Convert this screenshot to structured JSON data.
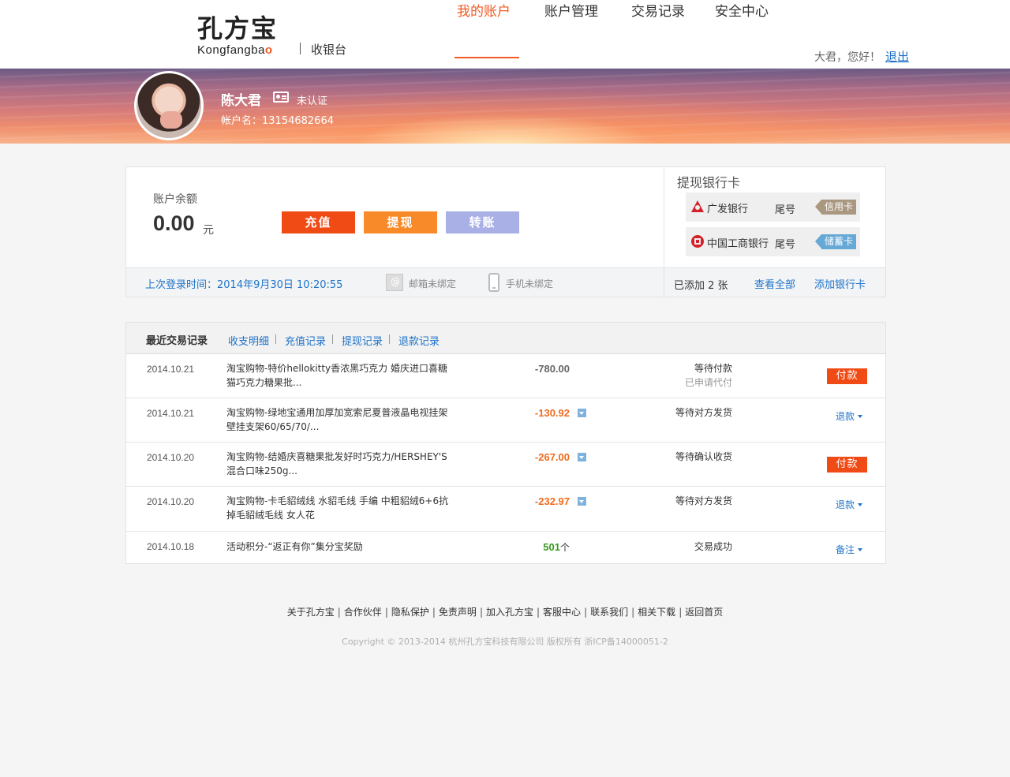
{
  "header": {
    "logo_cn": "孔方宝",
    "logo_en_prefix": "Kongfangba",
    "logo_en_suffix": "o",
    "subtitle": "收银台",
    "nav": [
      "我的账户",
      "账户管理",
      "交易记录",
      "安全中心"
    ],
    "greeting": "大君，您好！",
    "logout": "退出"
  },
  "profile": {
    "name": "陈大君",
    "verify_status": "未认证",
    "account_name": "帐户名：13154682664"
  },
  "account": {
    "balance_label": "账户余额",
    "balance": "0.00",
    "unit": "元",
    "buttons": {
      "recharge": "充值",
      "withdraw": "提现",
      "transfer": "转账"
    },
    "last_login": "上次登录时间：2014年9月30日   10:20:55",
    "email_status": "邮箱未绑定",
    "phone_status": "手机未绑定"
  },
  "bank_cards": {
    "title": "提现银行卡",
    "cards": [
      {
        "bank": "广发银行",
        "tail": "尾号",
        "type": "信用卡"
      },
      {
        "bank": "中国工商银行",
        "tail": "尾号",
        "type": "储蓄卡"
      }
    ],
    "added": "已添加 2 张",
    "view_all": "查看全部",
    "add_card": "添加银行卡"
  },
  "transactions": {
    "title": "最近交易记录",
    "tabs": [
      "收支明细",
      "充值记录",
      "提现记录",
      "退款记录"
    ],
    "rows": [
      {
        "date": "2014.10.21",
        "desc": "淘宝购物-特价hellokitty香浓黑巧克力 婚庆进口喜糖猫巧克力糖果批...",
        "amount": "-780.00",
        "unit": "",
        "status": "等待付款",
        "status_sub": "已申请代付",
        "action": "付款"
      },
      {
        "date": "2014.10.21",
        "desc": "淘宝购物-绿地宝通用加厚加宽索尼夏普液晶电视挂架壁挂支架60/65/70/...",
        "amount": "-130.92",
        "unit": "",
        "status": "等待对方发货",
        "status_sub": "",
        "action": "退款"
      },
      {
        "date": "2014.10.20",
        "desc": "淘宝购物-结婚庆喜糖果批发好时巧克力/HERSHEY'S混合口味250g...",
        "amount": "-267.00",
        "unit": "",
        "status": "等待确认收货",
        "status_sub": "",
        "action": "付款"
      },
      {
        "date": "2014.10.20",
        "desc": "淘宝购物-卡毛貂绒线 水貂毛线 手编 中粗貂绒6+6抗掉毛貂绒毛线 女人花",
        "amount": "-232.97",
        "unit": "",
        "status": "等待对方发货",
        "status_sub": "",
        "action": "退款"
      },
      {
        "date": "2014.10.18",
        "desc": "活动积分-“返正有你”集分宝奖励",
        "amount": "501",
        "unit": "个",
        "status": "交易成功",
        "status_sub": "",
        "action": "备注"
      }
    ]
  },
  "footer": {
    "links": [
      "关于孔方宝",
      "合作伙伴",
      "隐私保护",
      "免责声明",
      "加入孔方宝",
      "客服中心",
      "联系我们",
      "相关下载",
      "返回首页"
    ],
    "copyright": "Copyright © 2013-2014 杭州孔方宝科技有限公司 版权所有 浙ICP备14000051-2"
  },
  "colors": {
    "accent": "#f05a24",
    "link": "#1f74c9",
    "pay_button": "#f04b15",
    "withdraw_button": "#f98a2a",
    "transfer_button": "#a9b0e6"
  },
  "icons": [
    "id-card-icon",
    "email-icon",
    "phone-icon",
    "gf-bank-logo-icon",
    "icbc-bank-logo-icon",
    "dropdown-icon",
    "caret-down-icon"
  ]
}
